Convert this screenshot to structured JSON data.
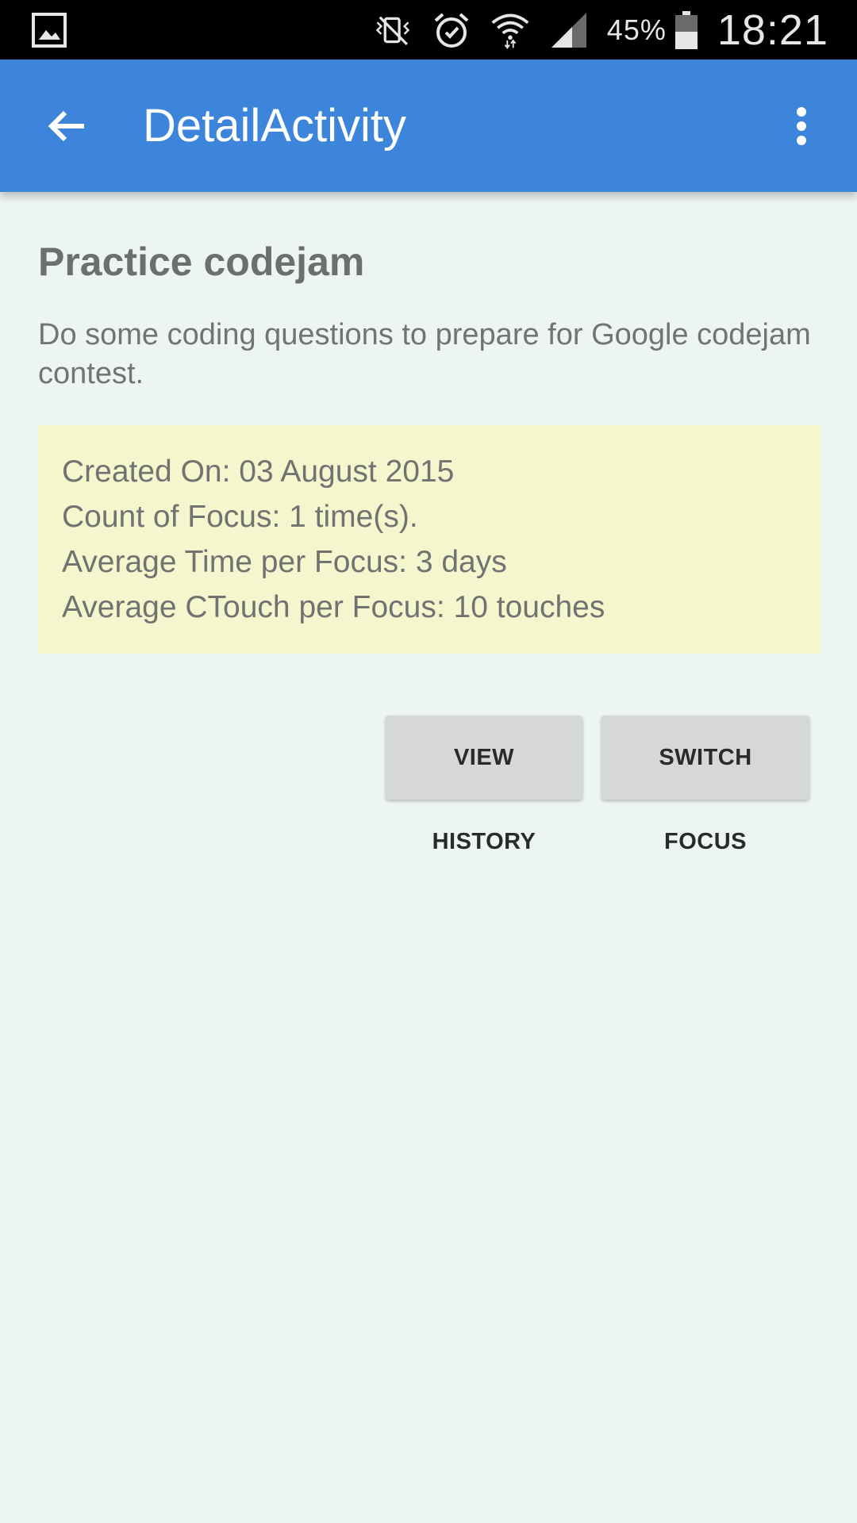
{
  "status_bar": {
    "left_icon": "gallery-notification-icon",
    "icons": [
      "vibrate-mute-icon",
      "alarm-icon",
      "wifi-icon",
      "cell-signal-icon"
    ],
    "battery_percent": "45%",
    "battery_icon": "battery-icon",
    "time": "18:21"
  },
  "app_bar": {
    "title": "DetailActivity",
    "back_icon": "back-arrow-icon",
    "overflow_icon": "more-vertical-icon",
    "color": "#3d85da"
  },
  "detail": {
    "title": "Practice codejam",
    "description": "Do some coding questions to prepare for Google codejam contest.",
    "info": {
      "created_on": "Created On: 03 August 2015",
      "count_of_focus": "Count of Focus: 1 time(s).",
      "avg_time": "Average Time per Focus: 3 days",
      "avg_ctouch": "Average CTouch per Focus: 10 touches"
    },
    "info_background": "#f4f6ce"
  },
  "actions": {
    "view_history": "VIEW HISTORY",
    "switch_focus": "SWITCH FOCUS"
  }
}
